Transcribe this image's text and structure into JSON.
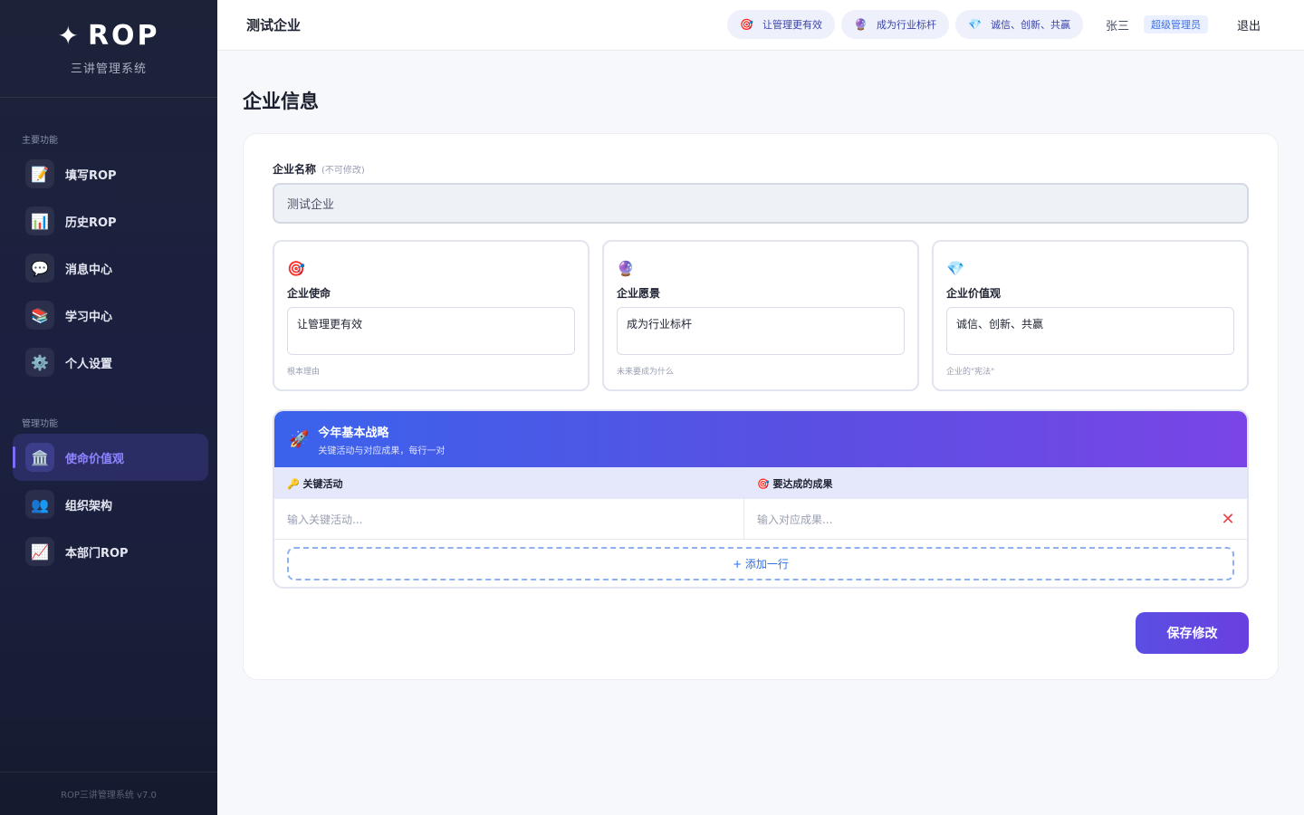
{
  "brand": {
    "star": "✦",
    "name": "ROP",
    "subtitle": "三讲管理系统"
  },
  "sidebar": {
    "sections": [
      {
        "title": "主要功能"
      },
      {
        "title": "管理功能"
      }
    ],
    "items": [
      {
        "label": "填写ROP",
        "icon": "📝",
        "icon_name": "memo-icon"
      },
      {
        "label": "历史ROP",
        "icon": "📊",
        "icon_name": "bar-chart-icon"
      },
      {
        "label": "消息中心",
        "icon": "💬",
        "icon_name": "chat-bubble-icon"
      },
      {
        "label": "学习中心",
        "icon": "📚",
        "icon_name": "books-icon"
      },
      {
        "label": "个人设置",
        "icon": "⚙️",
        "icon_name": "gear-icon"
      },
      {
        "label": "使命价值观",
        "icon": "🏛️",
        "icon_name": "classical-building-icon",
        "active": true
      },
      {
        "label": "组织架构",
        "icon": "👥",
        "icon_name": "people-icon"
      },
      {
        "label": "本部门ROP",
        "icon": "📈",
        "icon_name": "trend-chart-icon"
      }
    ],
    "footer": "ROP三讲管理系统 v7.0"
  },
  "topbar": {
    "company": "测试企业",
    "pills": [
      {
        "icon": "🎯",
        "text": "让管理更有效"
      },
      {
        "icon": "🔮",
        "text": "成为行业标杆"
      },
      {
        "icon": "💎",
        "text": "诚信、创新、共赢"
      }
    ],
    "user": "张三",
    "role": "超级管理员",
    "logout": "退出"
  },
  "page": {
    "title": "企业信息",
    "company_field": {
      "label": "企业名称",
      "hint": "(不可修改)",
      "value": "测试企业"
    },
    "mvv": [
      {
        "icon": "🎯",
        "title": "企业使命",
        "value": "让管理更有效",
        "note": "根本理由"
      },
      {
        "icon": "🔮",
        "title": "企业愿景",
        "value": "成为行业标杆",
        "note": "未来要成为什么"
      },
      {
        "icon": "💎",
        "title": "企业价值观",
        "value": "诚信、创新、共赢",
        "note": "企业的\"宪法\""
      }
    ],
    "strategy": {
      "icon": "🚀",
      "title": "今年基本战略",
      "subtitle": "关键活动与对应成果，每行一对",
      "col_activity": "🔑 关键活动",
      "col_result": "🎯 要达成的成果",
      "activity_placeholder": "输入关键活动...",
      "result_placeholder": "输入对应成果...",
      "delete_icon": "✕",
      "add_row": "+ 添加一行"
    },
    "save": "保存修改"
  },
  "colors": {
    "accent": "#5a4fe2",
    "sidebar_bg": "#1b2040",
    "danger": "#e5484d",
    "link": "#2f6fe8"
  }
}
